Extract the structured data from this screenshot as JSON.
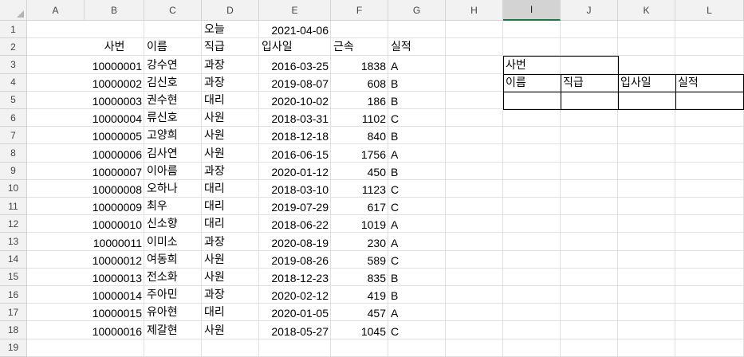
{
  "sheet": {
    "columns": [
      "A",
      "B",
      "C",
      "D",
      "E",
      "F",
      "G",
      "H",
      "I",
      "J",
      "K",
      "L"
    ],
    "selected_column": "I",
    "rows": [
      "1",
      "2",
      "3",
      "4",
      "5",
      "6",
      "7",
      "8",
      "9",
      "10",
      "11",
      "12",
      "13",
      "14",
      "15",
      "16",
      "17",
      "18",
      "19"
    ],
    "today_label": "오늘",
    "today_value": "2021-04-06",
    "table": {
      "headers": [
        "사번",
        "이름",
        "직급",
        "입사일",
        "근속",
        "실적"
      ],
      "rows": [
        [
          "10000001",
          "강수연",
          "과장",
          "2016-03-25",
          "1838",
          "A"
        ],
        [
          "10000002",
          "김신호",
          "과장",
          "2019-08-07",
          "608",
          "B"
        ],
        [
          "10000003",
          "권수현",
          "대리",
          "2020-10-02",
          "186",
          "B"
        ],
        [
          "10000004",
          "류신호",
          "사원",
          "2018-03-31",
          "1102",
          "C"
        ],
        [
          "10000005",
          "고양희",
          "사원",
          "2018-12-18",
          "840",
          "B"
        ],
        [
          "10000006",
          "김사연",
          "사원",
          "2016-06-15",
          "1756",
          "A"
        ],
        [
          "10000007",
          "이아름",
          "과장",
          "2020-01-12",
          "450",
          "B"
        ],
        [
          "10000008",
          "오하나",
          "대리",
          "2018-03-10",
          "1123",
          "C"
        ],
        [
          "10000009",
          "최우",
          "대리",
          "2019-07-29",
          "617",
          "C"
        ],
        [
          "10000010",
          "신소향",
          "대리",
          "2018-06-22",
          "1019",
          "A"
        ],
        [
          "10000011",
          "이미소",
          "과장",
          "2020-08-19",
          "230",
          "A"
        ],
        [
          "10000012",
          "여동희",
          "사원",
          "2019-08-26",
          "589",
          "C"
        ],
        [
          "10000013",
          "전소화",
          "사원",
          "2018-12-23",
          "835",
          "B"
        ],
        [
          "10000014",
          "주아민",
          "과장",
          "2020-02-12",
          "419",
          "B"
        ],
        [
          "10000015",
          "유아현",
          "대리",
          "2020-01-05",
          "457",
          "A"
        ],
        [
          "10000016",
          "제갈현",
          "사원",
          "2018-05-27",
          "1045",
          "C"
        ]
      ]
    },
    "lookup": {
      "id_label": "사번",
      "headers": [
        "이름",
        "직급",
        "입사일",
        "실적"
      ]
    }
  }
}
